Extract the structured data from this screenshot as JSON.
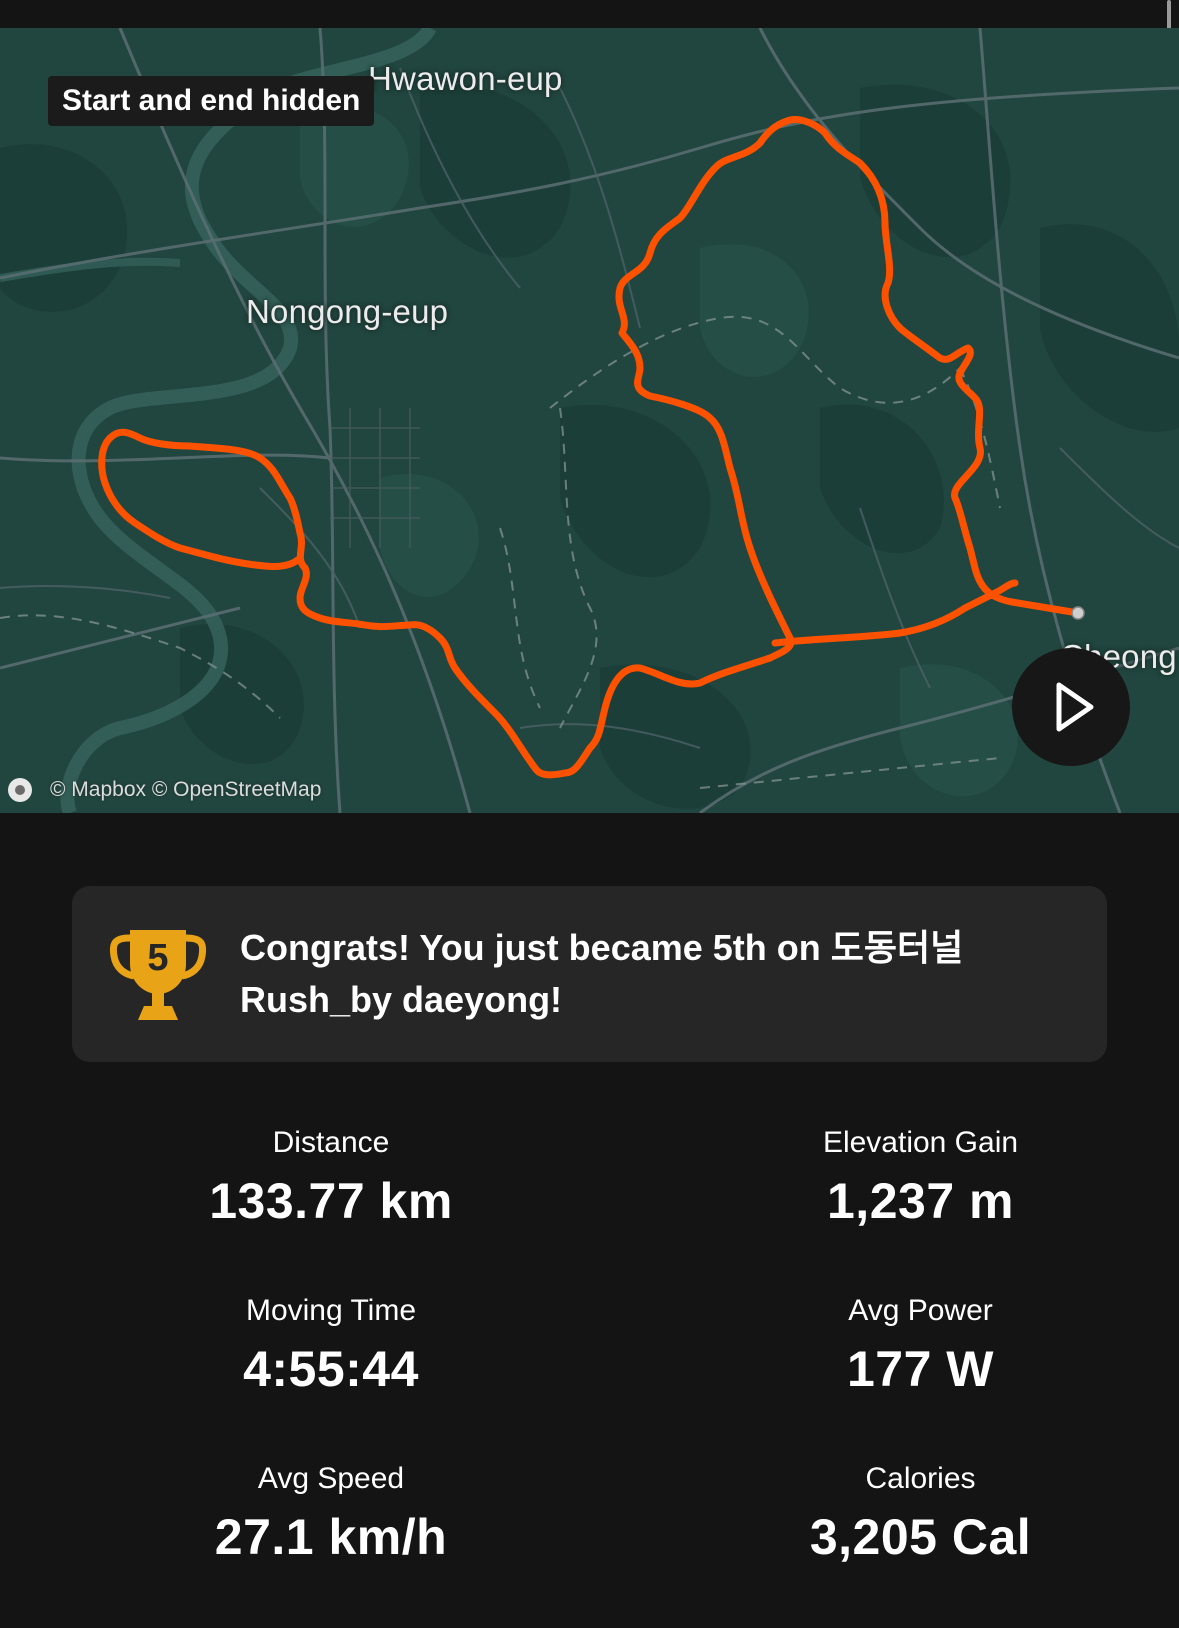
{
  "map": {
    "badge": "Start and end hidden",
    "places": [
      "Hwawon-eup",
      "Nongong-eup",
      "Cheong"
    ],
    "attribution": "© Mapbox © OpenStreetMap",
    "route_color": "#fc5200",
    "play_icon": "play-icon"
  },
  "achievement": {
    "icon": "trophy-icon",
    "rank_digit": "5",
    "text": "Congrats! You just became 5th on 도동터널 Rush_by daeyong!"
  },
  "stats": [
    {
      "label": "Distance",
      "value": "133.77 km"
    },
    {
      "label": "Elevation Gain",
      "value": "1,237 m"
    },
    {
      "label": "Moving Time",
      "value": "4:55:44"
    },
    {
      "label": "Avg Power",
      "value": "177 W"
    },
    {
      "label": "Avg Speed",
      "value": "27.1 km/h"
    },
    {
      "label": "Calories",
      "value": "3,205 Cal"
    }
  ]
}
